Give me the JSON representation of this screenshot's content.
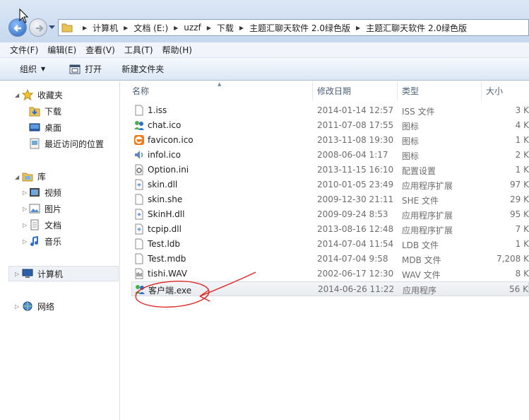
{
  "address": {
    "crumbs": [
      "计算机",
      "文档 (E:)",
      "uzzf",
      "下载",
      "主题汇聊天软件 2.0绿色版",
      "主题汇聊天软件 2.0绿色版"
    ]
  },
  "menu": [
    "文件(F)",
    "编辑(E)",
    "查看(V)",
    "工具(T)",
    "帮助(H)"
  ],
  "toolbar": {
    "organize_label": "组织",
    "open_label": "打开",
    "newfolder_label": "新建文件夹"
  },
  "nav": {
    "favorites": "收藏夹",
    "downloads": "下载",
    "desktop": "桌面",
    "recent": "最近访问的位置",
    "libraries": "库",
    "videos": "视频",
    "pictures": "图片",
    "documents": "文档",
    "music": "音乐",
    "computer": "计算机",
    "network": "网络"
  },
  "columns": {
    "name": "名称",
    "modified": "修改日期",
    "type": "类型",
    "size": "大小"
  },
  "files": [
    {
      "name": "1.iss",
      "date": "2014-01-14 12:57",
      "type": "ISS 文件",
      "size": "3 K",
      "icon": "text-file-icon"
    },
    {
      "name": "chat.ico",
      "date": "2011-07-08 17:55",
      "type": "图标",
      "size": "4 K",
      "icon": "chat-people-icon"
    },
    {
      "name": "favicon.ico",
      "date": "2013-11-08 19:30",
      "type": "图标",
      "size": "1 K",
      "icon": "orange-e-icon"
    },
    {
      "name": "infol.ico",
      "date": "2008-06-04 1:17",
      "type": "图标",
      "size": "2 K",
      "icon": "speaker-icon"
    },
    {
      "name": "Option.ini",
      "date": "2013-11-15 16:10",
      "type": "配置设置",
      "size": "1 K",
      "icon": "config-file-icon"
    },
    {
      "name": "skin.dll",
      "date": "2010-01-05 23:49",
      "type": "应用程序扩展",
      "size": "97 K",
      "icon": "dll-file-icon"
    },
    {
      "name": "skin.she",
      "date": "2009-12-30 21:11",
      "type": "SHE 文件",
      "size": "29 K",
      "icon": "blank-file-icon"
    },
    {
      "name": "SkinH.dll",
      "date": "2009-09-24 8:53",
      "type": "应用程序扩展",
      "size": "95 K",
      "icon": "dll-file-icon"
    },
    {
      "name": "tcpip.dll",
      "date": "2013-08-16 12:48",
      "type": "应用程序扩展",
      "size": "7 K",
      "icon": "dll-file-icon"
    },
    {
      "name": "Test.ldb",
      "date": "2014-07-04 11:54",
      "type": "LDB 文件",
      "size": "1 K",
      "icon": "blank-file-icon"
    },
    {
      "name": "Test.mdb",
      "date": "2014-07-04 9:58",
      "type": "MDB 文件",
      "size": "7,208 K",
      "icon": "blank-file-icon"
    },
    {
      "name": "tishi.WAV",
      "date": "2002-06-17 12:30",
      "type": "WAV 文件",
      "size": "8 K",
      "icon": "audio-file-icon"
    },
    {
      "name": "客户端.exe",
      "date": "2014-06-26 11:22",
      "type": "应用程序",
      "size": "56 K",
      "icon": "chat-people-icon"
    }
  ],
  "selected_index": 12
}
